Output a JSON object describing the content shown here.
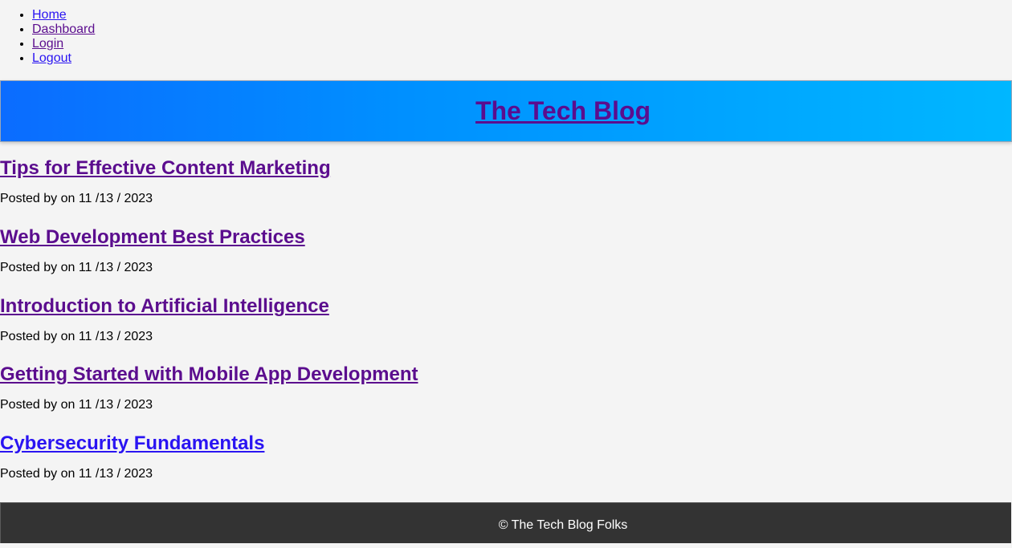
{
  "nav": {
    "items": [
      {
        "label": "Home"
      },
      {
        "label": "Dashboard"
      },
      {
        "label": "Login"
      },
      {
        "label": "Logout"
      }
    ]
  },
  "header": {
    "title": "The Tech Blog",
    "gradient_start": "#0b6cff",
    "gradient_end": "#00b7ff"
  },
  "posts": [
    {
      "title": "Tips for Effective Content Marketing",
      "meta": "Posted by  on 11 /13 / 2023"
    },
    {
      "title": "Web Development Best Practices",
      "meta": "Posted by  on 11 /13 / 2023"
    },
    {
      "title": "Introduction to Artificial Intelligence",
      "meta": "Posted by  on 11 /13 / 2023"
    },
    {
      "title": "Getting Started with Mobile App Development",
      "meta": "Posted by  on 11 /13 / 2023"
    },
    {
      "title": "Cybersecurity Fundamentals",
      "meta": "Posted by  on 11 /13 / 2023"
    }
  ],
  "footer": {
    "text": "© The Tech Blog Folks"
  },
  "colors": {
    "background": "#f4f4f4",
    "link_visited": "#5b0d8e",
    "link_unvisited": "#2a14f2",
    "footer_bg": "#333333",
    "footer_text": "#ffffff"
  }
}
